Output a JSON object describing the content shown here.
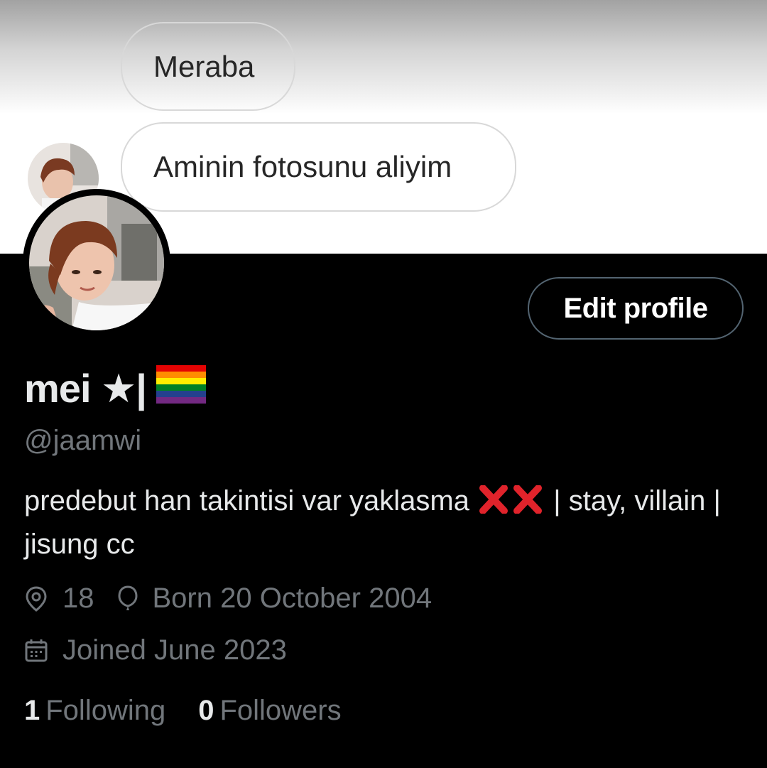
{
  "banner": {
    "messages": [
      "Meraba",
      "Aminin fotosunu aliyim"
    ]
  },
  "profile": {
    "edit_label": "Edit profile",
    "display_name": "mei ★|",
    "handle": "@jaamwi",
    "bio_part1": "predebut han takintisi var yaklasma",
    "bio_part2": "| stay, villain | jisung cc",
    "bio_icons": [
      "cross-mark-icon",
      "cross-mark-icon"
    ],
    "flag_icon": "rainbow-flag-icon",
    "location": "18",
    "birthday": "Born 20 October 2004",
    "joined": "Joined June 2023",
    "following_count": "1",
    "following_label": "Following",
    "followers_count": "0",
    "followers_label": "Followers"
  },
  "colors": {
    "background": "#000000",
    "primary_text": "#e7e9ea",
    "secondary_text": "#71767b",
    "button_border": "#536471",
    "cross_mark": "#e0232b"
  }
}
